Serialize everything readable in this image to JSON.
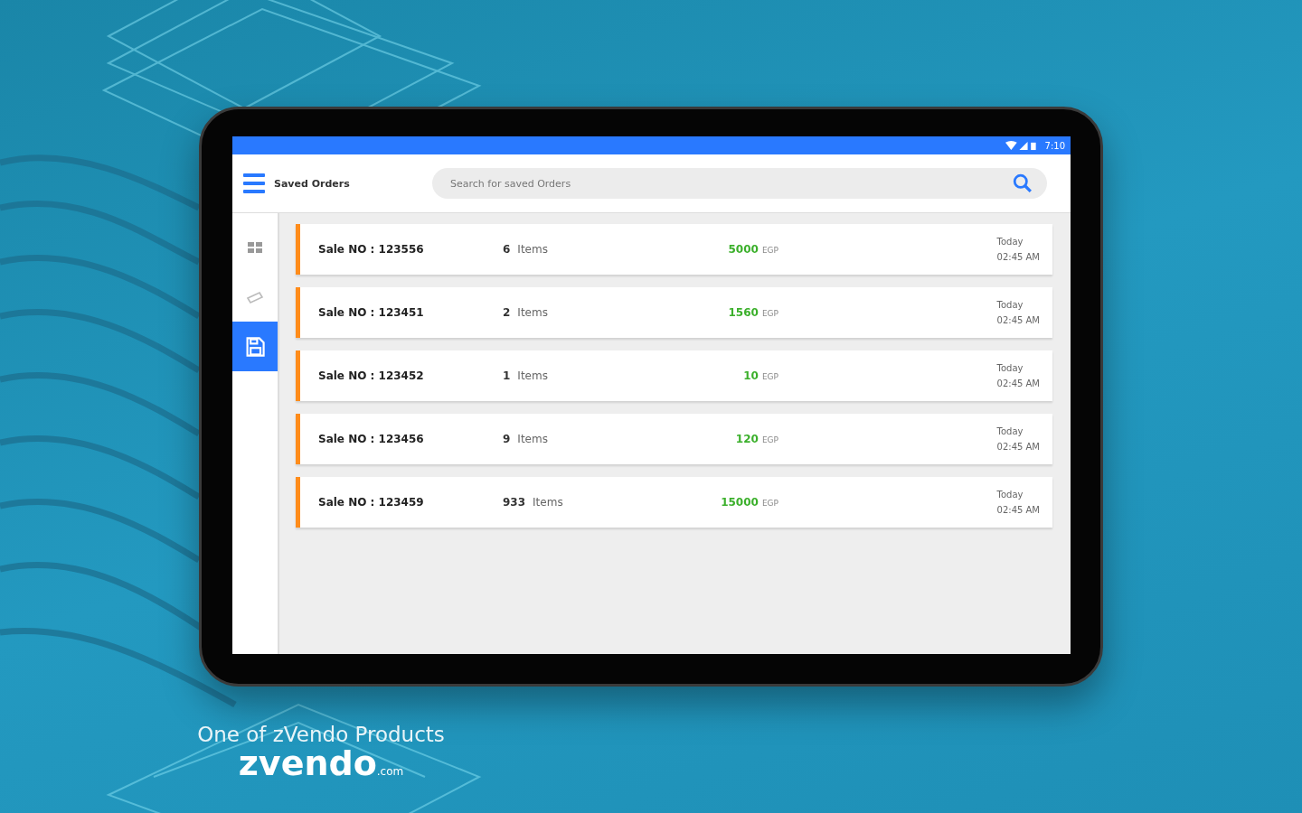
{
  "status_bar": {
    "time": "7:10"
  },
  "app_bar": {
    "title": "Saved Orders",
    "search": {
      "placeholder": "Search for saved Orders"
    }
  },
  "sidebar": {
    "items": [
      {
        "kind": "grid",
        "selected": false
      },
      {
        "kind": "ticket",
        "selected": false
      },
      {
        "kind": "save",
        "selected": true
      }
    ]
  },
  "orders": [
    {
      "sale_no": "Sale NO : 123556",
      "count": "6",
      "unit": "Items",
      "amount": "5000",
      "currency": "EGP",
      "day": "Today",
      "time": "02:45 AM"
    },
    {
      "sale_no": "Sale NO : 123451",
      "count": "2",
      "unit": "Items",
      "amount": "1560",
      "currency": "EGP",
      "day": "Today",
      "time": "02:45 AM"
    },
    {
      "sale_no": "Sale NO : 123452",
      "count": "1",
      "unit": "Items",
      "amount": "10",
      "currency": "EGP",
      "day": "Today",
      "time": "02:45 AM"
    },
    {
      "sale_no": "Sale NO : 123456",
      "count": "9",
      "unit": "Items",
      "amount": "120",
      "currency": "EGP",
      "day": "Today",
      "time": "02:45 AM"
    },
    {
      "sale_no": "Sale NO : 123459",
      "count": "933",
      "unit": "Items",
      "amount": "15000",
      "currency": "EGP",
      "day": "Today",
      "time": "02:45 AM"
    }
  ],
  "footer": {
    "tagline": "One of zVendo Products",
    "logo": "zvendo",
    "logo_suffix": ".com"
  }
}
